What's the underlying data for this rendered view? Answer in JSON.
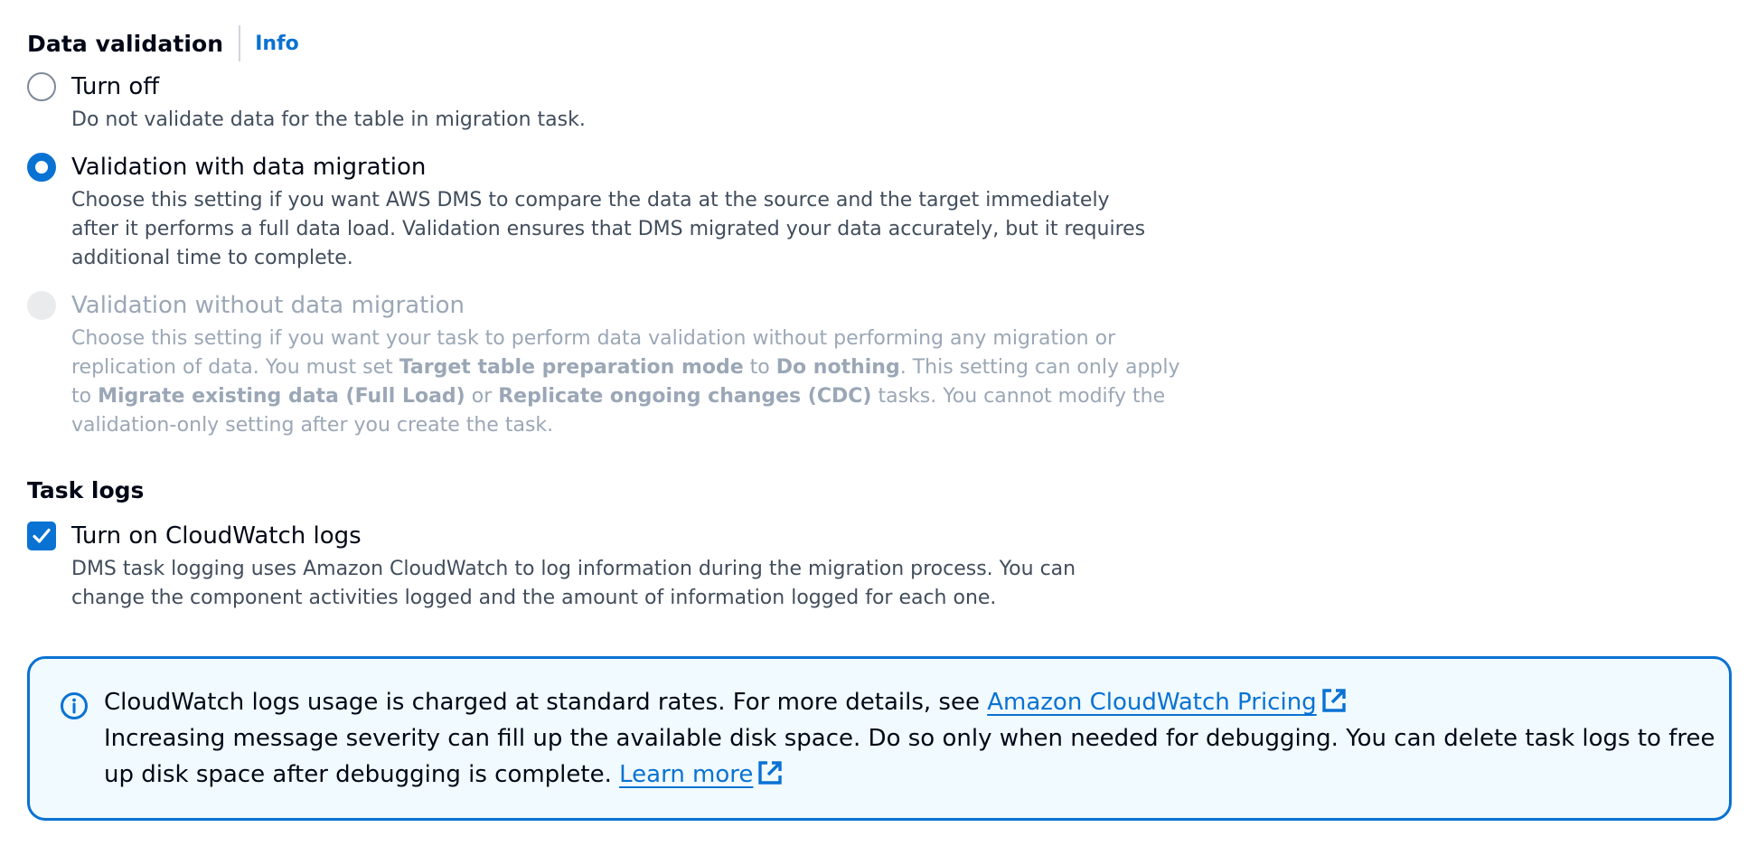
{
  "data_validation": {
    "title": "Data validation",
    "info_link": "Info",
    "options": [
      {
        "label": "Turn off",
        "description": "Do not validate data for the table in migration task.",
        "selected": false,
        "disabled": false
      },
      {
        "label": "Validation with data migration",
        "description_lines": [
          "Choose this setting if you want AWS DMS to compare the data at the source and the target immediately",
          "after it performs a full data load. Validation ensures that DMS migrated your data accurately, but it requires",
          "additional time to complete."
        ],
        "selected": true,
        "disabled": false
      },
      {
        "label": "Validation without data migration",
        "description_parts": {
          "l1": "Choose this setting if you want your task to perform data validation without performing any migration or",
          "l2a": "replication of data. You must set ",
          "l2b": "Target table preparation mode",
          "l2c": " to ",
          "l2d": "Do nothing",
          "l2e": ". This setting can only apply",
          "l3a": "to ",
          "l3b": "Migrate existing data (Full Load)",
          "l3c": " or ",
          "l3d": "Replicate ongoing changes (CDC)",
          "l3e": " tasks. You cannot modify the",
          "l4": "validation-only setting after you create the task."
        },
        "selected": false,
        "disabled": true
      }
    ]
  },
  "task_logs": {
    "title": "Task logs",
    "checkbox_label": "Turn on CloudWatch logs",
    "checked": true,
    "description_lines": [
      "DMS task logging uses Amazon CloudWatch to log information during the migration process. You can",
      "change the component activities logged and the amount of information logged for each one."
    ]
  },
  "alert": {
    "line1_text": "CloudWatch logs usage is charged at standard rates. For more details, see ",
    "line1_link": "Amazon CloudWatch Pricing",
    "line2_text": "Increasing message severity can fill up the available disk space. Do so only when needed for debugging. You can delete task logs to free",
    "line3_text": "up disk space after debugging is complete. ",
    "line3_link": "Learn more"
  },
  "colors": {
    "accent": "#0972d3",
    "text": "#000716",
    "secondary_text": "#414d5c",
    "disabled_text": "#9ba7b6",
    "alert_background": "#f1faff"
  },
  "icons": {
    "info": "info-circle-icon",
    "external": "external-link-icon",
    "check": "checkmark-icon"
  }
}
